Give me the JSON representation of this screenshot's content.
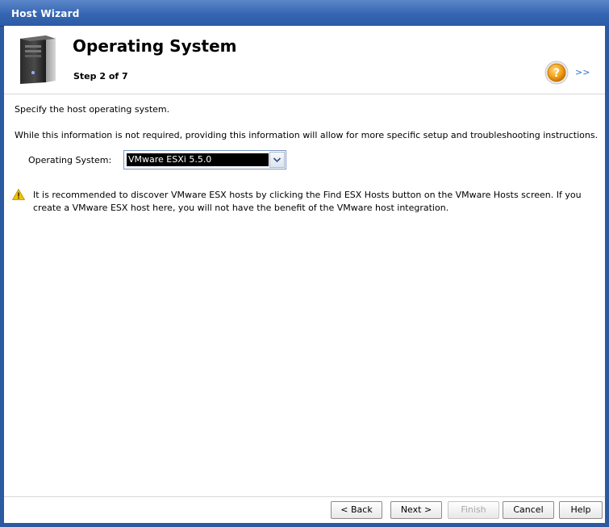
{
  "window": {
    "title": "Host Wizard"
  },
  "header": {
    "title": "Operating System",
    "step": "Step 2 of 7",
    "expand_link": ">>",
    "icons": {
      "server": "server-tower-icon",
      "help": "help-question-icon"
    }
  },
  "content": {
    "intro": "Specify the host operating system.",
    "info": "While this information is not required, providing this information will allow for more specific setup and troubleshooting instructions.",
    "os_field": {
      "label": "Operating System:",
      "value": "VMware ESXi 5.5.0"
    },
    "warning": {
      "icon": "warning-triangle-icon",
      "text": "It is recommended to discover VMware ESX hosts by clicking the Find ESX Hosts button on the VMware Hosts screen. If you create a VMware ESX host here, you will not have the benefit of the VMware host integration."
    }
  },
  "footer": {
    "back_label": "< Back",
    "next_label": "Next >",
    "finish_label": "Finish",
    "cancel_label": "Cancel",
    "help_label": "Help"
  },
  "colors": {
    "titlebar": "#3666b2",
    "link": "#2e73c8",
    "warning": "#f2c200"
  }
}
